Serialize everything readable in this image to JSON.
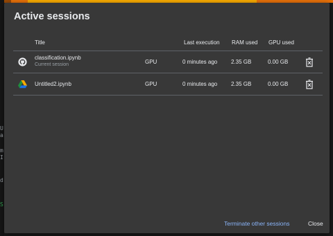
{
  "dialog": {
    "title": "Active sessions",
    "columns": {
      "title": "Title",
      "last_execution": "Last execution",
      "ram_used": "RAM used",
      "gpu_used": "GPU used"
    },
    "sessions": [
      {
        "icon": "github-icon",
        "title": "classification.ipynb",
        "subtitle": "Current session",
        "accelerator": "GPU",
        "last_execution": "0 minutes ago",
        "ram_used": "2.35 GB",
        "gpu_used": "0.00 GB"
      },
      {
        "icon": "google-drive-icon",
        "title": "Untitled2.ipynb",
        "subtitle": "",
        "accelerator": "GPU",
        "last_execution": "0 minutes ago",
        "ram_used": "2.35 GB",
        "gpu_used": "0.00 GB"
      }
    ],
    "buttons": {
      "terminate_other": "Terminate other sessions",
      "close": "Close"
    }
  },
  "background_fragments": [
    "U",
    "a",
    "m",
    "I",
    "d",
    "S"
  ],
  "colors": {
    "dialog_bg": "#383838",
    "accent_link": "#8ab4f8",
    "text_primary": "#e8eaed",
    "text_secondary": "#9aa0a6",
    "divider": "#5f6368",
    "top_strip": "#e8710a"
  }
}
